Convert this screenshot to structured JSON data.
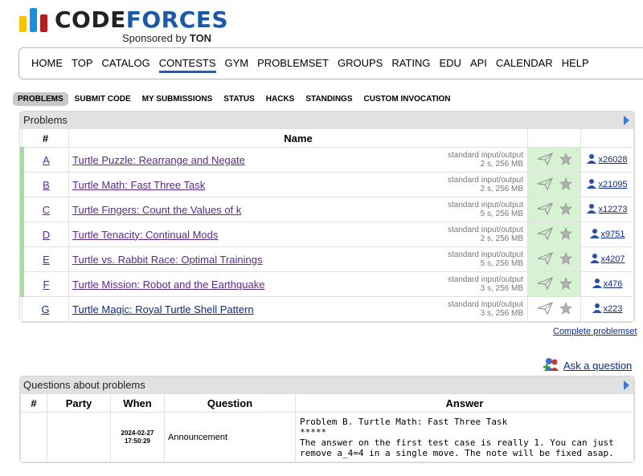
{
  "brand": {
    "logo_code": "CODE",
    "logo_forces": "FORCES",
    "sponsored_prefix": "Sponsored by",
    "sponsor": "TON"
  },
  "main_nav": [
    "HOME",
    "TOP",
    "CATALOG",
    "CONTESTS",
    "GYM",
    "PROBLEMSET",
    "GROUPS",
    "RATING",
    "EDU",
    "API",
    "CALENDAR",
    "HELP"
  ],
  "main_nav_active": "CONTESTS",
  "sub_nav": [
    "PROBLEMS",
    "SUBMIT CODE",
    "MY SUBMISSIONS",
    "STATUS",
    "HACKS",
    "STANDINGS",
    "CUSTOM INVOCATION"
  ],
  "sub_nav_active": "PROBLEMS",
  "problems": {
    "caption": "Problems",
    "headers": {
      "index": "#",
      "name": "Name"
    },
    "rows": [
      {
        "index": "A",
        "name": "Turtle Puzzle: Rearrange and Negate",
        "io": "standard input/output",
        "limits": "2 s, 256 MB",
        "solved": "x26028"
      },
      {
        "index": "B",
        "name": "Turtle Math: Fast Three Task",
        "io": "standard input/output",
        "limits": "2 s, 256 MB",
        "solved": "x21095"
      },
      {
        "index": "C",
        "name": "Turtle Fingers: Count the Values of k",
        "io": "standard input/output",
        "limits": "5 s, 256 MB",
        "solved": "x12273"
      },
      {
        "index": "D",
        "name": "Turtle Tenacity: Continual Mods",
        "io": "standard input/output",
        "limits": "2 s, 256 MB",
        "solved": "x9751"
      },
      {
        "index": "E",
        "name": "Turtle vs. Rabbit Race: Optimal Trainings",
        "io": "standard input/output",
        "limits": "5 s, 256 MB",
        "solved": "x4207"
      },
      {
        "index": "F",
        "name": "Turtle Mission: Robot and the Earthquake",
        "io": "standard input/output",
        "limits": "3 s, 256 MB",
        "solved": "x476"
      },
      {
        "index": "G",
        "name": "Turtle Magic: Royal Turtle Shell Pattern",
        "io": "standard input/output",
        "limits": "3 s, 256 MB",
        "solved": "x223"
      }
    ]
  },
  "complete_problemset": "Complete problemset",
  "ask_question": "Ask a question",
  "questions": {
    "caption": "Questions about problems",
    "headers": {
      "index": "#",
      "party": "Party",
      "when": "When",
      "question": "Question",
      "answer": "Answer"
    },
    "rows": [
      {
        "index": "",
        "party": "",
        "date": "2024-02-27",
        "time": "17:50:29",
        "question": "Announcement",
        "answer": "Problem B. Turtle Math: Fast Three Task\n*****\nThe answer on the first test case is really 1. You can just\nremove a_4=4 in a single move. The note will be fixed asap."
      }
    ]
  },
  "colors": {
    "accent_nav": "#3b5998",
    "accepted_green": "#a7dba2",
    "link_visited": "#5b2a86",
    "link": "#0a2a8c"
  }
}
